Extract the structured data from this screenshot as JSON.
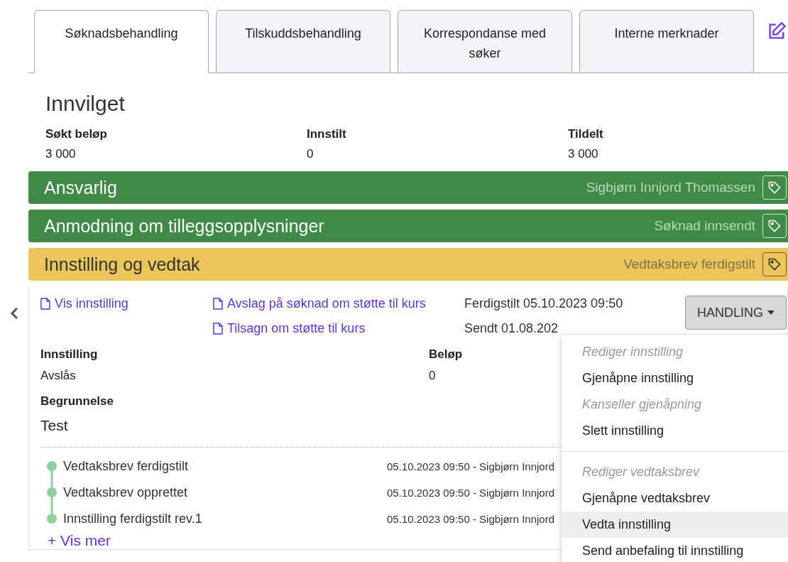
{
  "tabs": [
    {
      "label": "Søknadsbehandling",
      "selected": true
    },
    {
      "label": "Tilskuddsbehandling",
      "selected": false
    },
    {
      "label": "Korrespondanse med søker",
      "selected": false
    },
    {
      "label": "Interne merknader",
      "selected": false
    }
  ],
  "summary": {
    "status": "Innvilget",
    "fields": [
      {
        "label": "Søkt beløp",
        "value": "3 000"
      },
      {
        "label": "Innstilt",
        "value": "0"
      },
      {
        "label": "Tildelt",
        "value": "3 000"
      }
    ]
  },
  "sections": [
    {
      "title": "Ansvarlig",
      "status": "Sigbjørn Innjord Thomassen",
      "color": "#3e8a46",
      "expanded": false
    },
    {
      "title": "Anmodning om tilleggsopplysninger",
      "status": "Søknad innsendt",
      "color": "#3e8a46",
      "expanded": false
    },
    {
      "title": "Innstilling og vedtak",
      "status": "Vedtaksbrev ferdigstilt",
      "color": "#edc65b",
      "expanded": true
    }
  ],
  "panel": {
    "view_link": "Vis innstilling",
    "documents": [
      "Avslag på søknad om støtte til kurs",
      "Tilsagn om støtte til kurs"
    ],
    "dates": [
      "Ferdigstilt 05.10.2023 09:50",
      "Sendt 01.08.202"
    ],
    "action_button": "HANDLING",
    "details": [
      {
        "label": "Innstilling",
        "value": "Avslås"
      },
      {
        "label": "Beløp",
        "value": "0"
      }
    ],
    "reason_label": "Begrunnelse",
    "reason": "Test",
    "timeline": [
      {
        "event": "Vedtaksbrev ferdigstilt",
        "meta": "05.10.2023 09:50 - Sigbjørn Innjord"
      },
      {
        "event": "Vedtaksbrev opprettet",
        "meta": "05.10.2023 09:50 - Sigbjørn Innjord"
      },
      {
        "event": "Innstilling ferdigstilt rev.1",
        "meta": "05.10.2023 09:50 - Sigbjørn Innjord"
      }
    ],
    "show_more": "+ Vis mer"
  },
  "menu": {
    "groups": [
      {
        "items": [
          {
            "label": "Rediger innstilling",
            "disabled": true,
            "highlighted": false
          },
          {
            "label": "Gjenåpne innstilling",
            "disabled": false,
            "highlighted": false
          },
          {
            "label": "Kanseller gjenåpning",
            "disabled": true,
            "highlighted": false
          },
          {
            "label": "Slett innstilling",
            "disabled": false,
            "highlighted": false
          }
        ]
      },
      {
        "items": [
          {
            "label": "Rediger vedtaksbrev",
            "disabled": true,
            "highlighted": false
          },
          {
            "label": "Gjenåpne vedtaksbrev",
            "disabled": false,
            "highlighted": false
          },
          {
            "label": "Vedta innstilling",
            "disabled": false,
            "highlighted": true
          },
          {
            "label": "Send anbefaling til innstilling",
            "disabled": false,
            "highlighted": false
          }
        ]
      }
    ]
  }
}
